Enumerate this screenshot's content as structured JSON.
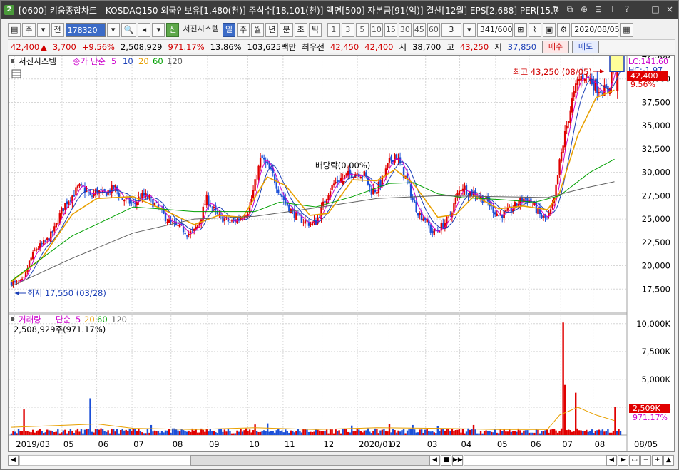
{
  "title": {
    "badge": "2",
    "text": "[0600] 키움종합차트 - KOSDAQ150 외국인보유[1,480(천)] 주식수[18,101(천)] 액면[500] 자본금[91(억)] 결산[12월] EPS[2,688] PER[15.7",
    "icons": [
      "restore-icon",
      "copy-icon",
      "link-icon",
      "pin-icon",
      "text-icon",
      "help-icon",
      "minimize-icon",
      "maximize-icon",
      "close-icon"
    ],
    "icon_glyphs": [
      "⇅",
      "⧉",
      "⊕",
      "⊟",
      "T",
      "?",
      "_",
      "□",
      "×"
    ]
  },
  "toolbar": {
    "type_select": "주",
    "prev_label": "전",
    "code": "178320",
    "system_label": "서진시스템",
    "system_badge": "신",
    "periods": [
      "일",
      "주",
      "월",
      "년",
      "분",
      "초",
      "틱"
    ],
    "numbers": [
      "1",
      "3",
      "5",
      "10",
      "15",
      "30",
      "45",
      "60"
    ],
    "count_value": "3",
    "range": "341/600",
    "date": "2020/08/05"
  },
  "quote": {
    "price": "42,400",
    "arrow": "▲",
    "change": "3,700",
    "pct": "+9.56%",
    "volume": "2,508,929",
    "vol_ratio": "971.17%",
    "turnover": "13.86%",
    "amount": "103,625백만",
    "bid_label": "최우선",
    "ask": "42,450",
    "bid": "42,400",
    "open_label": "시",
    "open": "38,700",
    "high_label": "고",
    "high": "43,250",
    "low_label": "저",
    "low": "37,850",
    "buy_label": "매수",
    "sell_label": "매도"
  },
  "price_panel": {
    "legend_name": "서진시스템",
    "legend_ma": "종가 단순",
    "ma_periods": [
      "5",
      "10",
      "20",
      "60",
      "120"
    ],
    "ma_colors": [
      "#cc00cc",
      "#1b3fb7",
      "#e8a000",
      "#00a000",
      "#606060"
    ],
    "lc_label": "LC:141.60",
    "hc_label": "HC:-1.97",
    "price_tag": "42,400",
    "pct_tag": "9.56%",
    "high_annot": "최고 43,250 (08/05)",
    "low_annot": "최저 17,550 (03/28)",
    "dividend_annot": "배당락(0.00%)"
  },
  "volume_panel": {
    "legend_name": "거래량",
    "legend_ma": "단순",
    "ma_periods": [
      "5",
      "20",
      "60",
      "120"
    ],
    "readout": "2,508,929주(971.17%)",
    "vol_tag": "2,509K",
    "ratio_tag": "971.17%"
  },
  "colors": {
    "up": "#e00000",
    "down": "#1b4fd8"
  },
  "chart_data": [
    {
      "type": "candlestick",
      "title": "",
      "ylim": [
        15000,
        42500
      ],
      "yticks": [
        "42,500",
        "40,000",
        "37,500",
        "35,000",
        "32,500",
        "30,000",
        "27,500",
        "25,000",
        "22,500",
        "20,000",
        "17,500"
      ],
      "ytick_values": [
        42500,
        40000,
        37500,
        35000,
        32500,
        30000,
        27500,
        25000,
        22500,
        20000,
        17500
      ],
      "xticks": [
        "2019/03",
        "05",
        "06",
        "07",
        "08",
        "09",
        "10",
        "11",
        "12",
        "2020/01",
        "02",
        "03",
        "04",
        "05",
        "06",
        "07",
        "08"
      ],
      "xtick_pos": [
        0.005,
        0.083,
        0.14,
        0.198,
        0.262,
        0.322,
        0.388,
        0.446,
        0.51,
        0.568,
        0.62,
        0.68,
        0.736,
        0.795,
        0.85,
        0.902,
        0.955
      ],
      "extra_xtick": "08/05",
      "close_path": [
        [
          0.0,
          18200
        ],
        [
          0.01,
          18100
        ],
        [
          0.02,
          18400
        ],
        [
          0.03,
          20500
        ],
        [
          0.04,
          21800
        ],
        [
          0.05,
          22200
        ],
        [
          0.06,
          22800
        ],
        [
          0.07,
          23800
        ],
        [
          0.08,
          25500
        ],
        [
          0.09,
          26800
        ],
        [
          0.1,
          27500
        ],
        [
          0.11,
          28400
        ],
        [
          0.12,
          28200
        ],
        [
          0.13,
          27300
        ],
        [
          0.14,
          28100
        ],
        [
          0.15,
          27600
        ],
        [
          0.16,
          28000
        ],
        [
          0.17,
          28400
        ],
        [
          0.18,
          27200
        ],
        [
          0.19,
          27000
        ],
        [
          0.2,
          26500
        ],
        [
          0.21,
          27300
        ],
        [
          0.22,
          27500
        ],
        [
          0.23,
          26900
        ],
        [
          0.24,
          26200
        ],
        [
          0.25,
          25400
        ],
        [
          0.26,
          24600
        ],
        [
          0.27,
          24200
        ],
        [
          0.28,
          24000
        ],
        [
          0.29,
          23400
        ],
        [
          0.3,
          23700
        ],
        [
          0.31,
          24900
        ],
        [
          0.32,
          27200
        ],
        [
          0.33,
          26200
        ],
        [
          0.34,
          25200
        ],
        [
          0.35,
          25000
        ],
        [
          0.36,
          24600
        ],
        [
          0.37,
          24900
        ],
        [
          0.38,
          25400
        ],
        [
          0.39,
          26000
        ],
        [
          0.4,
          28800
        ],
        [
          0.41,
          31600
        ],
        [
          0.42,
          30600
        ],
        [
          0.43,
          29600
        ],
        [
          0.44,
          27900
        ],
        [
          0.45,
          26800
        ],
        [
          0.46,
          25800
        ],
        [
          0.47,
          25200
        ],
        [
          0.48,
          24800
        ],
        [
          0.49,
          24500
        ],
        [
          0.5,
          24700
        ],
        [
          0.51,
          26200
        ],
        [
          0.52,
          27900
        ],
        [
          0.53,
          28800
        ],
        [
          0.54,
          29300
        ],
        [
          0.55,
          29600
        ],
        [
          0.56,
          29900
        ],
        [
          0.57,
          30000
        ],
        [
          0.58,
          29700
        ],
        [
          0.59,
          28000
        ],
        [
          0.6,
          28200
        ],
        [
          0.61,
          29300
        ],
        [
          0.62,
          31000
        ],
        [
          0.63,
          32000
        ],
        [
          0.64,
          30500
        ],
        [
          0.65,
          29000
        ],
        [
          0.66,
          26800
        ],
        [
          0.67,
          25500
        ],
        [
          0.68,
          25000
        ],
        [
          0.69,
          23500
        ],
        [
          0.7,
          23800
        ],
        [
          0.71,
          24500
        ],
        [
          0.72,
          25300
        ],
        [
          0.73,
          27200
        ],
        [
          0.74,
          28600
        ],
        [
          0.75,
          27900
        ],
        [
          0.76,
          27800
        ],
        [
          0.77,
          27300
        ],
        [
          0.78,
          27000
        ],
        [
          0.79,
          26100
        ],
        [
          0.8,
          25400
        ],
        [
          0.81,
          25600
        ],
        [
          0.82,
          26000
        ],
        [
          0.83,
          26600
        ],
        [
          0.84,
          27200
        ],
        [
          0.85,
          27000
        ],
        [
          0.86,
          26200
        ],
        [
          0.87,
          25200
        ],
        [
          0.88,
          25000
        ],
        [
          0.89,
          26500
        ],
        [
          0.9,
          31000
        ],
        [
          0.91,
          34500
        ],
        [
          0.92,
          37500
        ],
        [
          0.93,
          39800
        ],
        [
          0.94,
          40500
        ],
        [
          0.95,
          39900
        ],
        [
          0.96,
          39200
        ],
        [
          0.97,
          38800
        ],
        [
          0.98,
          38700
        ],
        [
          0.99,
          42400
        ]
      ],
      "ma_paths": {
        "20": [
          [
            0.0,
            18300
          ],
          [
            0.05,
            20800
          ],
          [
            0.1,
            25500
          ],
          [
            0.14,
            27200
          ],
          [
            0.2,
            27400
          ],
          [
            0.25,
            26000
          ],
          [
            0.3,
            24400
          ],
          [
            0.34,
            25400
          ],
          [
            0.38,
            25200
          ],
          [
            0.42,
            29500
          ],
          [
            0.45,
            28600
          ],
          [
            0.49,
            25400
          ],
          [
            0.52,
            25600
          ],
          [
            0.56,
            29200
          ],
          [
            0.6,
            29100
          ],
          [
            0.63,
            30300
          ],
          [
            0.66,
            28800
          ],
          [
            0.7,
            25200
          ],
          [
            0.73,
            25500
          ],
          [
            0.76,
            27500
          ],
          [
            0.8,
            26100
          ],
          [
            0.84,
            26400
          ],
          [
            0.88,
            26000
          ],
          [
            0.9,
            27800
          ],
          [
            0.93,
            34000
          ],
          [
            0.96,
            38000
          ],
          [
            0.99,
            38800
          ]
        ],
        "60": [
          [
            0.0,
            18400
          ],
          [
            0.1,
            23200
          ],
          [
            0.2,
            26300
          ],
          [
            0.3,
            25800
          ],
          [
            0.4,
            25800
          ],
          [
            0.44,
            26800
          ],
          [
            0.5,
            26300
          ],
          [
            0.56,
            27400
          ],
          [
            0.62,
            28800
          ],
          [
            0.66,
            28900
          ],
          [
            0.7,
            27700
          ],
          [
            0.74,
            27300
          ],
          [
            0.8,
            27100
          ],
          [
            0.86,
            26800
          ],
          [
            0.9,
            27500
          ],
          [
            0.95,
            30000
          ],
          [
            0.99,
            31400
          ]
        ],
        "120": [
          [
            0.0,
            17800
          ],
          [
            0.1,
            20800
          ],
          [
            0.2,
            23500
          ],
          [
            0.3,
            25000
          ],
          [
            0.4,
            25300
          ],
          [
            0.5,
            26200
          ],
          [
            0.6,
            27200
          ],
          [
            0.7,
            27500
          ],
          [
            0.8,
            27400
          ],
          [
            0.88,
            27300
          ],
          [
            0.94,
            28300
          ],
          [
            0.99,
            29000
          ]
        ]
      },
      "forecast_box": {
        "low": 40800,
        "high": 43300
      }
    },
    {
      "type": "bar",
      "title": "",
      "ylim": [
        0,
        10500
      ],
      "yticks": [
        "10,000K",
        "7,500K",
        "5,000K",
        "2,500K"
      ],
      "ytick_values": [
        10000,
        7500,
        5000,
        2500
      ],
      "spikes": [
        [
          0.02,
          2300
        ],
        [
          0.13,
          3300
        ],
        [
          0.23,
          900
        ],
        [
          0.4,
          950
        ],
        [
          0.42,
          1050
        ],
        [
          0.56,
          850
        ],
        [
          0.62,
          1000
        ],
        [
          0.66,
          900
        ],
        [
          0.7,
          800
        ],
        [
          0.76,
          900
        ],
        [
          0.905,
          10100
        ],
        [
          0.91,
          4500
        ],
        [
          0.925,
          3800
        ],
        [
          0.99,
          2509
        ]
      ],
      "ma20_path": [
        [
          0.0,
          700
        ],
        [
          0.1,
          900
        ],
        [
          0.14,
          1000
        ],
        [
          0.2,
          600
        ],
        [
          0.3,
          500
        ],
        [
          0.4,
          650
        ],
        [
          0.5,
          500
        ],
        [
          0.6,
          650
        ],
        [
          0.7,
          600
        ],
        [
          0.8,
          500
        ],
        [
          0.88,
          500
        ],
        [
          0.9,
          1800
        ],
        [
          0.93,
          2500
        ],
        [
          0.96,
          1800
        ],
        [
          0.99,
          1300
        ]
      ]
    }
  ],
  "bottom": {
    "buttons": [
      "◀",
      "■",
      "▶▶",
      "◀",
      "▶",
      "▭",
      "−",
      "+",
      "▲"
    ]
  }
}
